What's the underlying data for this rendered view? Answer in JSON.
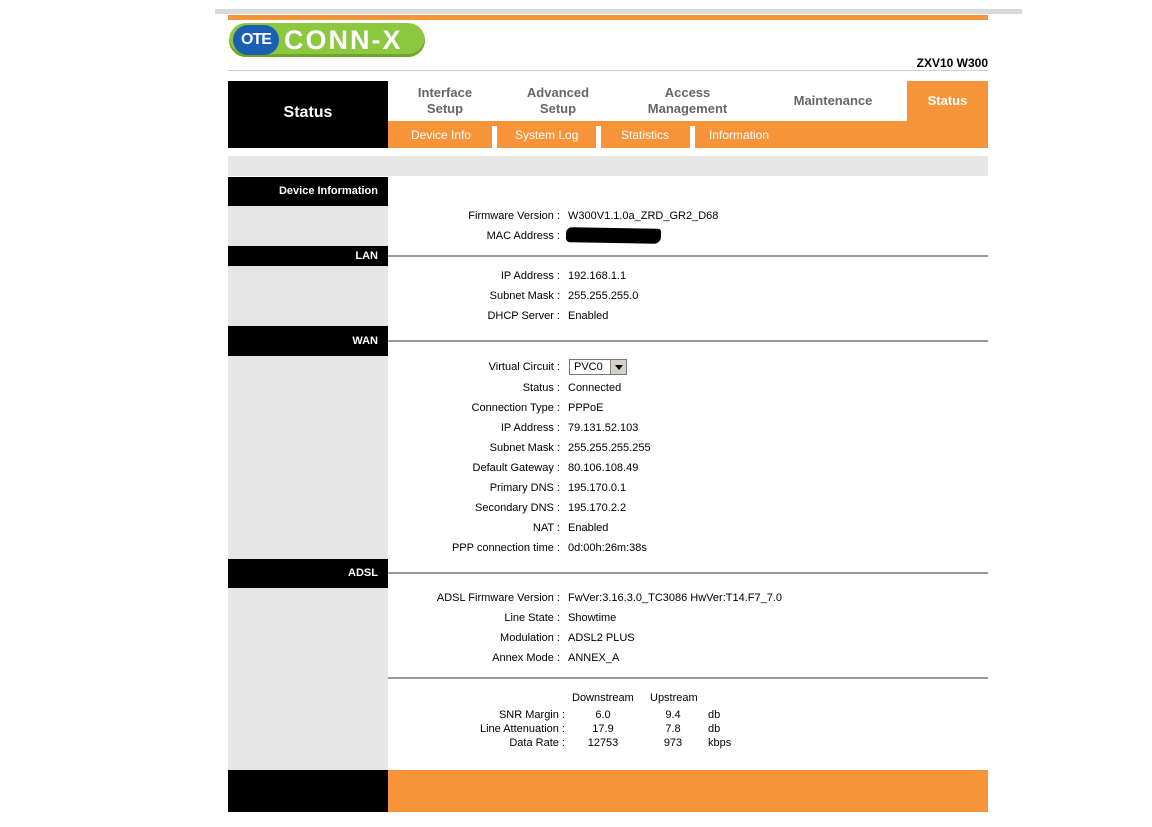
{
  "brand": {
    "logo_ote": "OTE",
    "logo_name": "CONN-X",
    "model": "ZXV10 W300",
    "colors": {
      "accent": "#f7943a",
      "logo_green": "#8dc63f",
      "logo_blue": "#1a5fb4"
    }
  },
  "nav": {
    "section_title": "Status",
    "tabs": [
      {
        "line1": "Interface",
        "line2": "Setup"
      },
      {
        "line1": "Advanced",
        "line2": "Setup"
      },
      {
        "line1": "Access",
        "line2": "Management"
      },
      {
        "line1": "Maintenance",
        "line2": ""
      },
      {
        "line1": "Status",
        "line2": ""
      }
    ],
    "subtabs": [
      "Device Info",
      "System Log",
      "Statistics",
      "Information"
    ]
  },
  "sections": {
    "device": {
      "title": "Device Information",
      "rows": [
        {
          "label": "Firmware Version",
          "value": "W300V1.1.0a_ZRD_GR2_D68"
        },
        {
          "label": "MAC Address",
          "value": ""
        }
      ]
    },
    "lan": {
      "title": "LAN",
      "rows": [
        {
          "label": "IP Address",
          "value": "192.168.1.1"
        },
        {
          "label": "Subnet Mask",
          "value": "255.255.255.0"
        },
        {
          "label": "DHCP Server",
          "value": "Enabled"
        }
      ]
    },
    "wan": {
      "title": "WAN",
      "virtual_circuit": {
        "label": "Virtual Circuit",
        "selected": "PVC0"
      },
      "rows": [
        {
          "label": "Status",
          "value": "Connected"
        },
        {
          "label": "Connection Type",
          "value": "PPPoE"
        },
        {
          "label": "IP Address",
          "value": "79.131.52.103"
        },
        {
          "label": "Subnet Mask",
          "value": "255.255.255.255"
        },
        {
          "label": "Default Gateway",
          "value": "80.106.108.49"
        },
        {
          "label": "Primary DNS",
          "value": "195.170.0.1"
        },
        {
          "label": "Secondary DNS",
          "value": "195.170.2.2"
        },
        {
          "label": "NAT",
          "value": "Enabled"
        },
        {
          "label": "PPP connection time",
          "value": "0d:00h:26m:38s"
        }
      ]
    },
    "adsl": {
      "title": "ADSL",
      "rows": [
        {
          "label": "ADSL Firmware Version",
          "value": "FwVer:3.16.3.0_TC3086 HwVer:T14.F7_7.0"
        },
        {
          "label": "Line State",
          "value": "Showtime"
        },
        {
          "label": "Modulation",
          "value": "ADSL2 PLUS"
        },
        {
          "label": "Annex Mode",
          "value": "ANNEX_A"
        }
      ],
      "stats": {
        "headers": {
          "downstream": "Downstream",
          "upstream": "Upstream"
        },
        "rows": [
          {
            "label": "SNR Margin",
            "down": "6.0",
            "up": "9.4",
            "unit": "db"
          },
          {
            "label": "Line Attenuation",
            "down": "17.9",
            "up": "7.8",
            "unit": "db"
          },
          {
            "label": "Data Rate",
            "down": "12753",
            "up": "973",
            "unit": "kbps"
          }
        ]
      }
    }
  }
}
